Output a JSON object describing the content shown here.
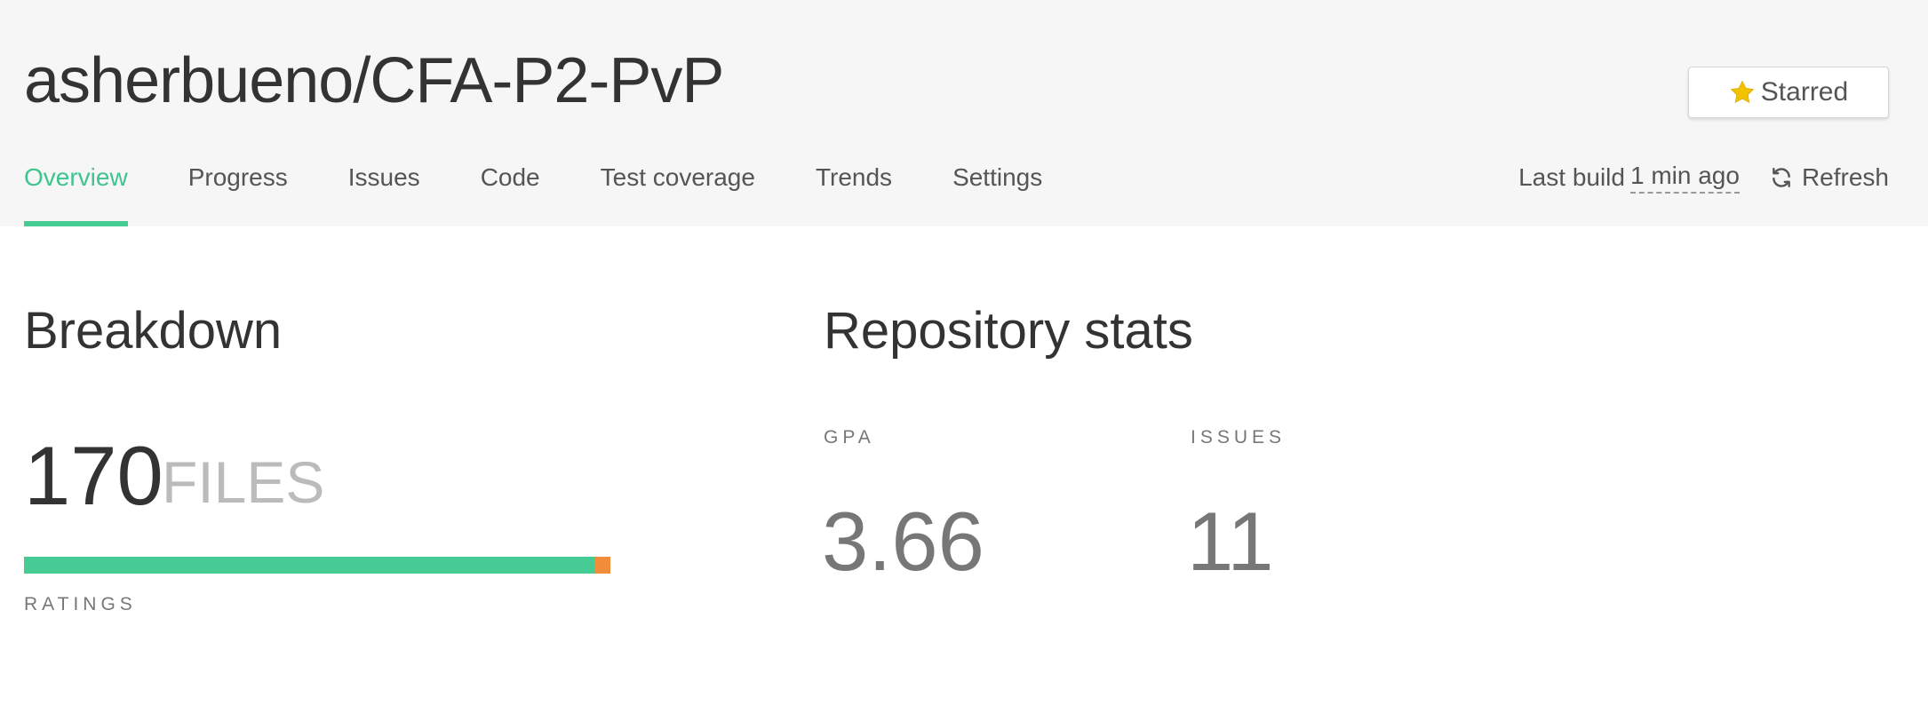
{
  "header": {
    "repo_title": "asherbueno/CFA-P2-PvP",
    "star_button": {
      "label": "Starred",
      "icon": "star-icon"
    },
    "tabs": [
      {
        "label": "Overview",
        "active": true
      },
      {
        "label": "Progress",
        "active": false
      },
      {
        "label": "Issues",
        "active": false
      },
      {
        "label": "Code",
        "active": false
      },
      {
        "label": "Test coverage",
        "active": false
      },
      {
        "label": "Trends",
        "active": false
      },
      {
        "label": "Settings",
        "active": false
      }
    ],
    "build": {
      "prefix": "Last build",
      "time": "1 min ago",
      "refresh_label": "Refresh",
      "refresh_icon": "refresh-icon"
    }
  },
  "breakdown": {
    "title": "Breakdown",
    "files_count": "170",
    "files_label": "FILES",
    "ratings_label": "RATINGS",
    "ratings_bar": [
      {
        "fraction": 0.972,
        "color": "#45cb93"
      },
      {
        "fraction": 0.028,
        "color": "#f08c3a"
      }
    ]
  },
  "repo_stats": {
    "title": "Repository stats",
    "gpa_label": "GPA",
    "gpa_value": "3.66",
    "issues_label": "ISSUES",
    "issues_value": "11"
  },
  "colors": {
    "accent": "#45cb93",
    "star": "#f2c200",
    "header_bg": "#f6f6f6"
  }
}
